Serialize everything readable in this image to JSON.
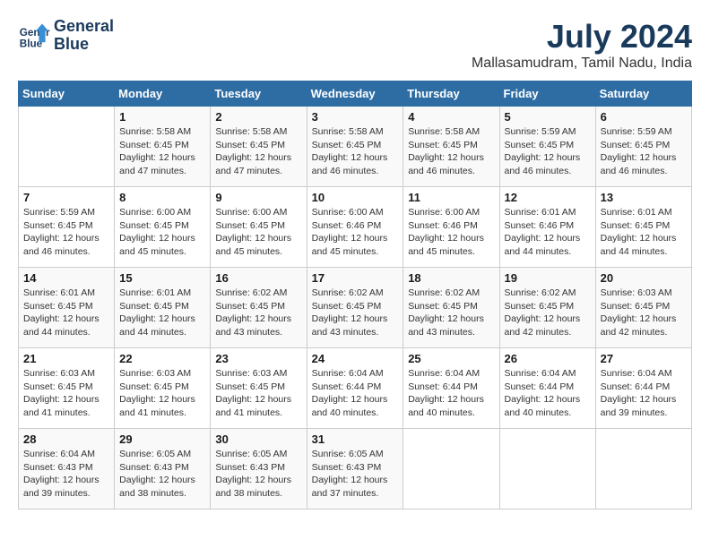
{
  "header": {
    "logo_line1": "General",
    "logo_line2": "Blue",
    "month_year": "July 2024",
    "location": "Mallasamudram, Tamil Nadu, India"
  },
  "days_of_week": [
    "Sunday",
    "Monday",
    "Tuesday",
    "Wednesday",
    "Thursday",
    "Friday",
    "Saturday"
  ],
  "weeks": [
    [
      {
        "day": "",
        "info": ""
      },
      {
        "day": "1",
        "info": "Sunrise: 5:58 AM\nSunset: 6:45 PM\nDaylight: 12 hours\nand 47 minutes."
      },
      {
        "day": "2",
        "info": "Sunrise: 5:58 AM\nSunset: 6:45 PM\nDaylight: 12 hours\nand 47 minutes."
      },
      {
        "day": "3",
        "info": "Sunrise: 5:58 AM\nSunset: 6:45 PM\nDaylight: 12 hours\nand 46 minutes."
      },
      {
        "day": "4",
        "info": "Sunrise: 5:58 AM\nSunset: 6:45 PM\nDaylight: 12 hours\nand 46 minutes."
      },
      {
        "day": "5",
        "info": "Sunrise: 5:59 AM\nSunset: 6:45 PM\nDaylight: 12 hours\nand 46 minutes."
      },
      {
        "day": "6",
        "info": "Sunrise: 5:59 AM\nSunset: 6:45 PM\nDaylight: 12 hours\nand 46 minutes."
      }
    ],
    [
      {
        "day": "7",
        "info": "Sunrise: 5:59 AM\nSunset: 6:45 PM\nDaylight: 12 hours\nand 46 minutes."
      },
      {
        "day": "8",
        "info": "Sunrise: 6:00 AM\nSunset: 6:45 PM\nDaylight: 12 hours\nand 45 minutes."
      },
      {
        "day": "9",
        "info": "Sunrise: 6:00 AM\nSunset: 6:45 PM\nDaylight: 12 hours\nand 45 minutes."
      },
      {
        "day": "10",
        "info": "Sunrise: 6:00 AM\nSunset: 6:46 PM\nDaylight: 12 hours\nand 45 minutes."
      },
      {
        "day": "11",
        "info": "Sunrise: 6:00 AM\nSunset: 6:46 PM\nDaylight: 12 hours\nand 45 minutes."
      },
      {
        "day": "12",
        "info": "Sunrise: 6:01 AM\nSunset: 6:46 PM\nDaylight: 12 hours\nand 44 minutes."
      },
      {
        "day": "13",
        "info": "Sunrise: 6:01 AM\nSunset: 6:45 PM\nDaylight: 12 hours\nand 44 minutes."
      }
    ],
    [
      {
        "day": "14",
        "info": "Sunrise: 6:01 AM\nSunset: 6:45 PM\nDaylight: 12 hours\nand 44 minutes."
      },
      {
        "day": "15",
        "info": "Sunrise: 6:01 AM\nSunset: 6:45 PM\nDaylight: 12 hours\nand 44 minutes."
      },
      {
        "day": "16",
        "info": "Sunrise: 6:02 AM\nSunset: 6:45 PM\nDaylight: 12 hours\nand 43 minutes."
      },
      {
        "day": "17",
        "info": "Sunrise: 6:02 AM\nSunset: 6:45 PM\nDaylight: 12 hours\nand 43 minutes."
      },
      {
        "day": "18",
        "info": "Sunrise: 6:02 AM\nSunset: 6:45 PM\nDaylight: 12 hours\nand 43 minutes."
      },
      {
        "day": "19",
        "info": "Sunrise: 6:02 AM\nSunset: 6:45 PM\nDaylight: 12 hours\nand 42 minutes."
      },
      {
        "day": "20",
        "info": "Sunrise: 6:03 AM\nSunset: 6:45 PM\nDaylight: 12 hours\nand 42 minutes."
      }
    ],
    [
      {
        "day": "21",
        "info": "Sunrise: 6:03 AM\nSunset: 6:45 PM\nDaylight: 12 hours\nand 41 minutes."
      },
      {
        "day": "22",
        "info": "Sunrise: 6:03 AM\nSunset: 6:45 PM\nDaylight: 12 hours\nand 41 minutes."
      },
      {
        "day": "23",
        "info": "Sunrise: 6:03 AM\nSunset: 6:45 PM\nDaylight: 12 hours\nand 41 minutes."
      },
      {
        "day": "24",
        "info": "Sunrise: 6:04 AM\nSunset: 6:44 PM\nDaylight: 12 hours\nand 40 minutes."
      },
      {
        "day": "25",
        "info": "Sunrise: 6:04 AM\nSunset: 6:44 PM\nDaylight: 12 hours\nand 40 minutes."
      },
      {
        "day": "26",
        "info": "Sunrise: 6:04 AM\nSunset: 6:44 PM\nDaylight: 12 hours\nand 40 minutes."
      },
      {
        "day": "27",
        "info": "Sunrise: 6:04 AM\nSunset: 6:44 PM\nDaylight: 12 hours\nand 39 minutes."
      }
    ],
    [
      {
        "day": "28",
        "info": "Sunrise: 6:04 AM\nSunset: 6:43 PM\nDaylight: 12 hours\nand 39 minutes."
      },
      {
        "day": "29",
        "info": "Sunrise: 6:05 AM\nSunset: 6:43 PM\nDaylight: 12 hours\nand 38 minutes."
      },
      {
        "day": "30",
        "info": "Sunrise: 6:05 AM\nSunset: 6:43 PM\nDaylight: 12 hours\nand 38 minutes."
      },
      {
        "day": "31",
        "info": "Sunrise: 6:05 AM\nSunset: 6:43 PM\nDaylight: 12 hours\nand 37 minutes."
      },
      {
        "day": "",
        "info": ""
      },
      {
        "day": "",
        "info": ""
      },
      {
        "day": "",
        "info": ""
      }
    ]
  ]
}
